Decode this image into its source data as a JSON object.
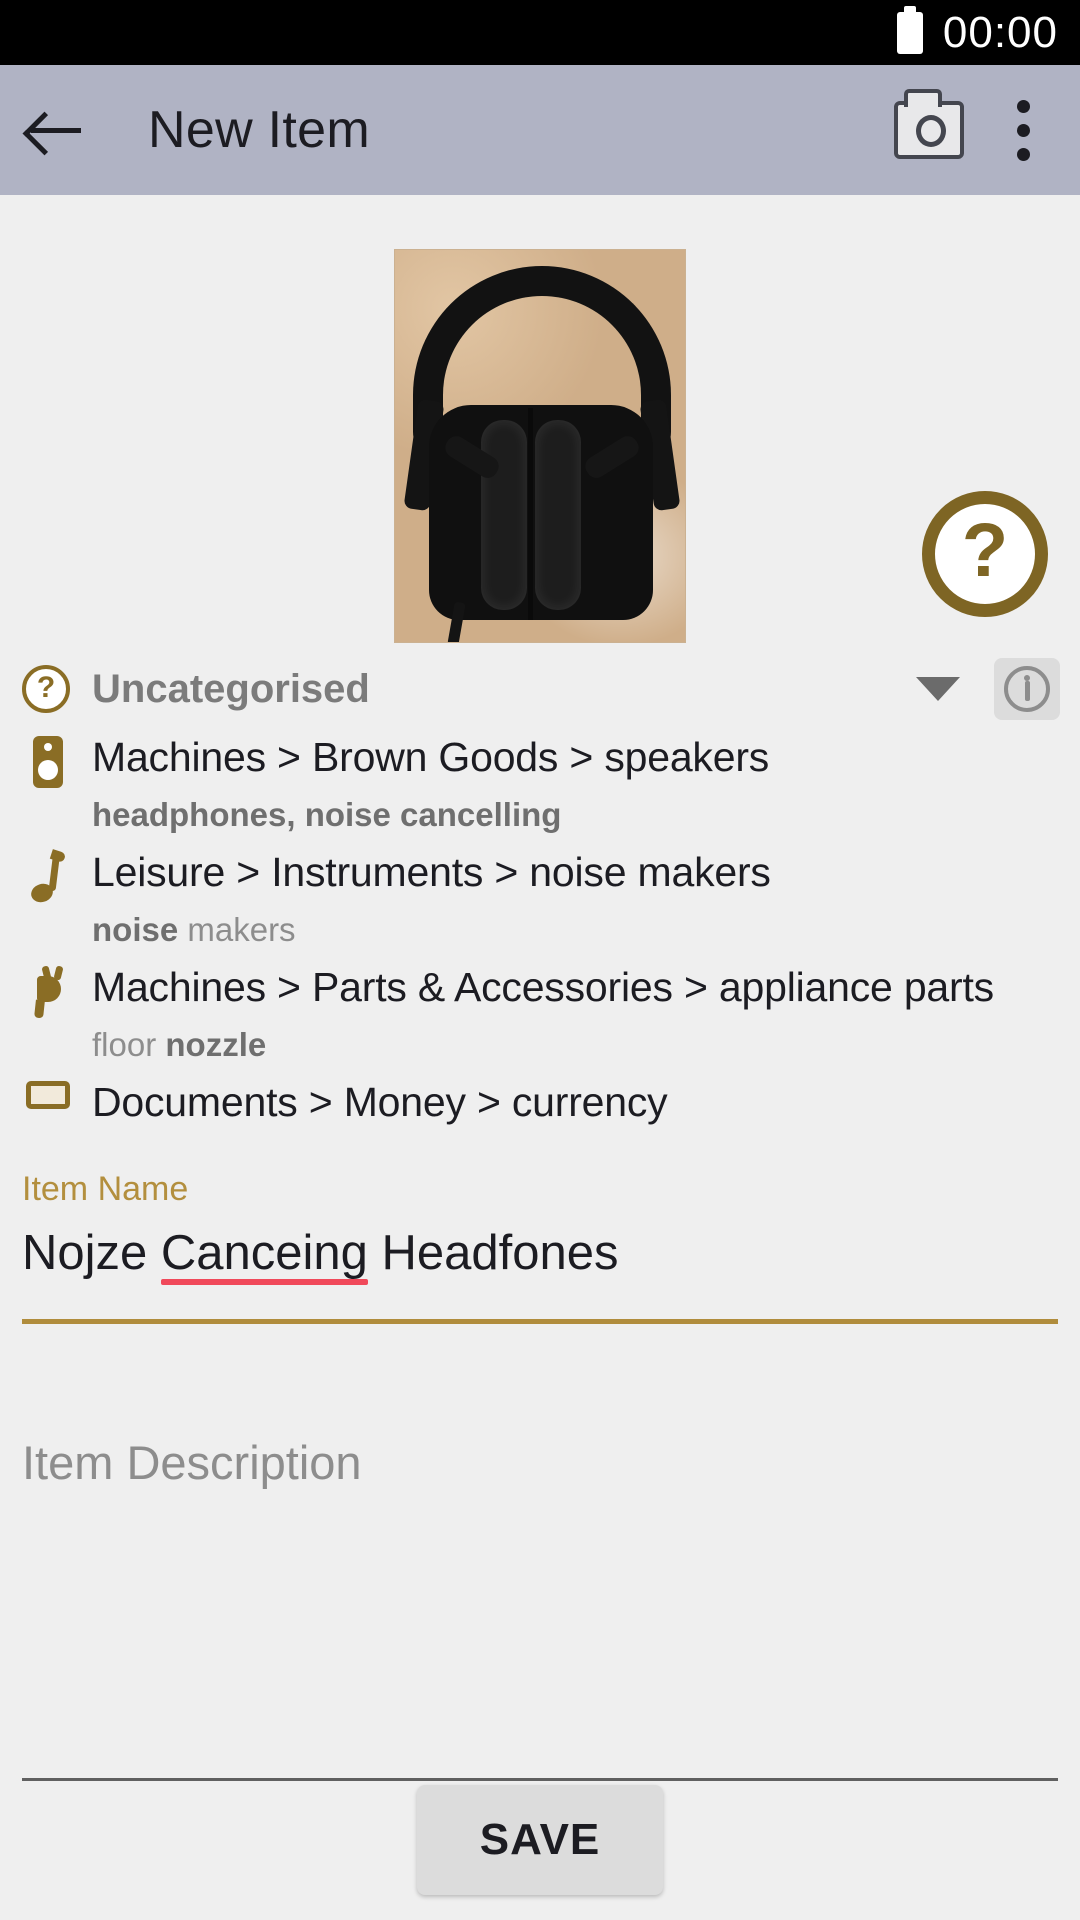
{
  "status_bar": {
    "time": "00:00",
    "battery_icon": "battery-full-icon"
  },
  "app_bar": {
    "back_icon": "back-arrow-icon",
    "title": "New Item",
    "camera_icon": "camera-icon",
    "overflow_icon": "overflow-menu-icon"
  },
  "photo": {
    "alt": "item-photo-headphones"
  },
  "help_fab": {
    "glyph": "?",
    "icon": "help-question-icon"
  },
  "category": {
    "icon": "uncategorised-question-icon",
    "label": "Uncategorised",
    "caret_icon": "chevron-down-icon",
    "info_icon": "info-icon"
  },
  "suggestions": [
    {
      "icon": "speaker-icon",
      "path": "Machines > Brown Goods > speakers",
      "keywords_pre": "",
      "keywords_bold": "headphones, noise cancelling",
      "keywords_post": ""
    },
    {
      "icon": "music-note-icon",
      "path": "Leisure > Instruments > noise makers",
      "keywords_pre": "",
      "keywords_bold": "noise",
      "keywords_post": " makers"
    },
    {
      "icon": "plug-icon",
      "path": "Machines > Parts & Accessories > appliance parts",
      "keywords_pre": "floor ",
      "keywords_bold": "nozzle",
      "keywords_post": ""
    },
    {
      "icon": "money-icon",
      "path": "Documents > Money > currency",
      "keywords_pre": "",
      "keywords_bold": "",
      "keywords_post": ""
    }
  ],
  "item_name": {
    "label": "Item Name",
    "value_part1": "Nojze ",
    "value_misspelled": "Canceing",
    "value_part2": " Headfones"
  },
  "item_description": {
    "placeholder": "Item Description",
    "value": ""
  },
  "save": {
    "label": "SAVE"
  },
  "colors": {
    "accent_gold": "#8a6d25",
    "label_gold": "#b38f3e",
    "appbar": "#b0b3c4",
    "background": "#efefef",
    "spellcheck_red": "#f0495a"
  }
}
